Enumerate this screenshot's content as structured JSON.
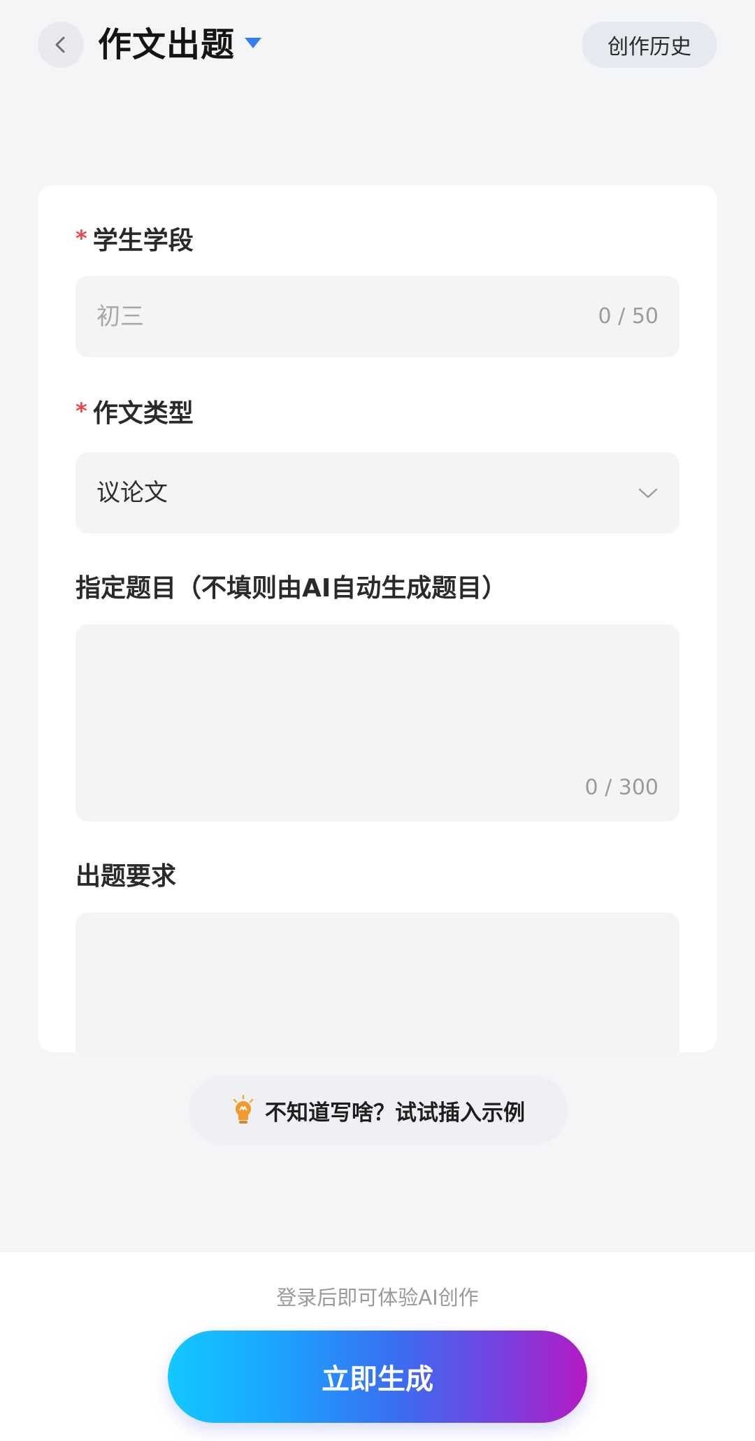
{
  "header": {
    "title": "作文出题",
    "history_label": "创作历史"
  },
  "form": {
    "stage": {
      "label": "学生学段",
      "required_mark": "*",
      "placeholder": "初三",
      "counter": "0 / 50"
    },
    "type": {
      "label": "作文类型",
      "required_mark": "*",
      "value": "议论文"
    },
    "topic": {
      "label": "指定题目（不填则由AI自动生成题目）",
      "counter": "0 / 300"
    },
    "requirement": {
      "label": "出题要求"
    }
  },
  "tip": {
    "text": "不知道写啥？试试插入示例"
  },
  "footer": {
    "login_hint": "登录后即可体验AI创作",
    "generate_label": "立即生成"
  },
  "colors": {
    "accent": "#2f7ff0",
    "required": "#f04848"
  },
  "icons": {
    "back": "chevron-left-icon",
    "dropdown": "chevron-down-icon",
    "tip": "lightbulb-icon"
  }
}
